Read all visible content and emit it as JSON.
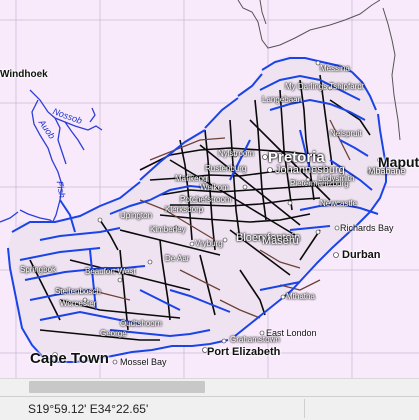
{
  "map": {
    "background": "#f9eafb",
    "road_color": "#1a44e8",
    "river_color": "#2e3fd6",
    "dense_color": "#0a0a0a",
    "brown_color": "#6e4238",
    "labels": {
      "windhoek": "Windhoek",
      "pretoria": "Pretoria",
      "johannesburg": "Johannesburg",
      "maputo": "Maputo",
      "mbabane": "Mbabane",
      "bloemfontein": "Bloemfontein",
      "maseru": "Maseru",
      "durban": "Durban",
      "richards_bay": "Richards Bay",
      "east_london": "East London",
      "port_elizabeth": "Port Elizabeth",
      "cape_town": "Cape Town",
      "mossel_bay": "Mossel Bay",
      "grahamstown": "Grahamstown",
      "mthatha": "Mthatha",
      "vryburg": "Vryburg",
      "kimberley": "Kimberley",
      "messina": "Messina",
      "my_darlings_tshipfardt": "My Darlings Tshipfardt",
      "langebaan": "Langebaan",
      "nelspruit": "Nelspruit",
      "newcastle": "Newcastle",
      "nylstroom": "Nylstroom",
      "upington": "Upington",
      "springbok": "Springbok",
      "george": "George",
      "oudtshoorn": "Oudtshoorn",
      "worcester": "Worcester",
      "beaufort_west": "Beaufort West",
      "de_aar": "De Aar",
      "pietermaritzburg": "Pietermaritzburg",
      "stellenbosch": "Stellenbosch",
      "welkom": "Welkom",
      "ladysmith": "Ladysmith",
      "potchefstroom": "Potchefstroom",
      "klerksdorp": "Klerksdorp",
      "rustenburg": "Rustenburg",
      "mafikeng": "Mafikeng"
    },
    "rivers": {
      "nossob": "Nossob",
      "auob": "Auob",
      "fish": "Fish"
    }
  },
  "status_bar": {
    "coordinates": "S19°59.12' E34°22.65'"
  },
  "scrollbar": {
    "horizontal_position": 0.07,
    "horizontal_visible": 0.42
  }
}
